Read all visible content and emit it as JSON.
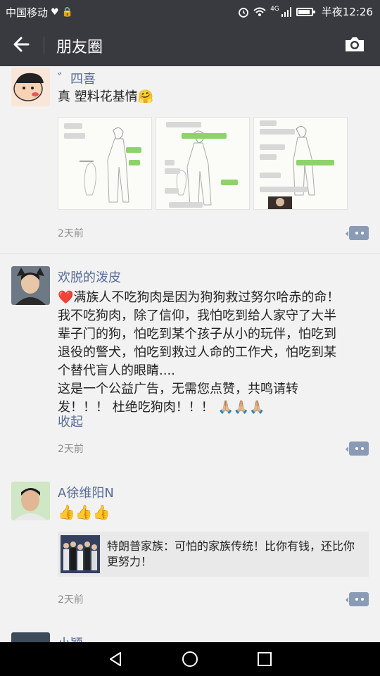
{
  "status_bar": {
    "carrier": "中国移动",
    "network": "4G",
    "time": "半夜12:26"
  },
  "header": {
    "title": "朋友圈"
  },
  "posts": [
    {
      "author": "゛四喜",
      "text": "真 塑料花基情",
      "emoji": "🤗",
      "time": "2天前"
    },
    {
      "author": "欢脱的泼皮",
      "lines": [
        "❤️满族人不吃狗肉是因为狗狗救过努尔哈赤的命！",
        "我不吃狗肉，除了信仰，我怕吃到给人家守了大半",
        "辈子门的狗，怕吃到某个孩子从小的玩伴，怕吃到",
        "退役的警犬，怕吃到救过人命的工作犬，怕吃到某",
        "个替代盲人的眼睛....",
        "这是一个公益广告，无需您点赞，共鸣请转",
        "发！！！ 杜绝吃狗肉！！！"
      ],
      "emojis": "🙏🏼🙏🏼🙏🏼",
      "collapse_label": "收起",
      "time": "2天前"
    },
    {
      "author": "A徐维阳N",
      "emojis": "👍👍👍",
      "link_title": "特朗普家族：可怕的家族传统！比你有钱，还比你更努力！",
      "time": "2天前"
    },
    {
      "author": "小颖"
    }
  ]
}
